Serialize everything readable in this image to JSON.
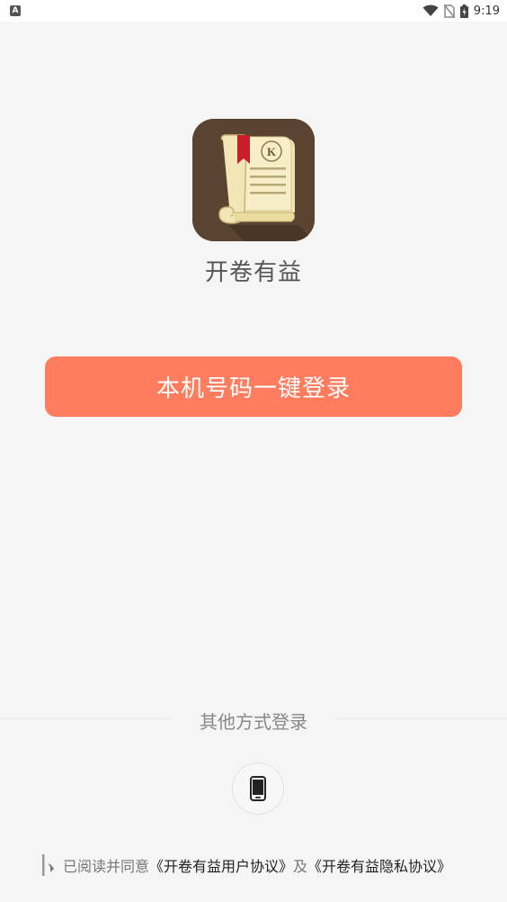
{
  "status_bar": {
    "left_icon_letter": "A",
    "time": "9:19",
    "icons": [
      "wifi-icon",
      "no-sim-icon",
      "battery-icon"
    ]
  },
  "app": {
    "icon_letter": "K",
    "name": "开卷有益"
  },
  "login": {
    "one_click_label": "本机号码一键登录"
  },
  "other_login": {
    "label": "其他方式登录",
    "phone_icon": "phone-icon"
  },
  "agreement": {
    "prefix": "已阅读并同意",
    "user_agreement": "《开卷有益用户协议》",
    "conjunction": "及",
    "privacy_agreement": "《开卷有益隐私协议》"
  },
  "colors": {
    "background": "#f5f5f5",
    "primary_button": "#ff7d5e",
    "icon_background": "#5b4331"
  }
}
